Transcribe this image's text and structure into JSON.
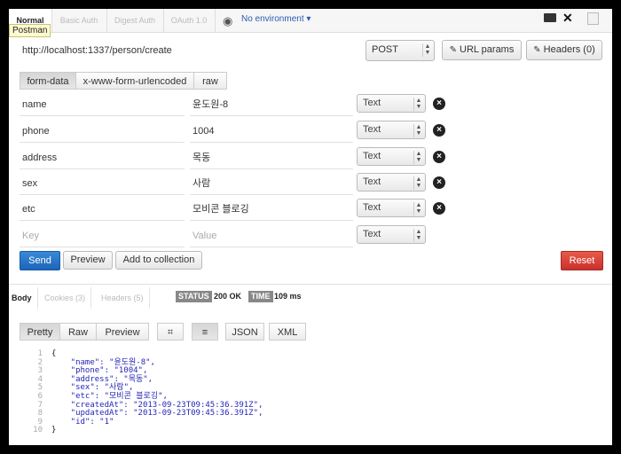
{
  "auth_tabs": [
    "Normal",
    "Basic Auth",
    "Digest Auth",
    "OAuth 1.0"
  ],
  "tooltip": "Postman",
  "environment": "No environment ▾",
  "url": "http://localhost:1337/person/create",
  "method": "POST",
  "url_params_label": "URL params",
  "headers_label": "Headers (0)",
  "body_modes": [
    "form-data",
    "x-www-form-urlencoded",
    "raw"
  ],
  "params": [
    {
      "key": "name",
      "value": "윤도원-8",
      "type": "Text"
    },
    {
      "key": "phone",
      "value": "1004",
      "type": "Text"
    },
    {
      "key": "address",
      "value": "목동",
      "type": "Text"
    },
    {
      "key": "sex",
      "value": "사람",
      "type": "Text"
    },
    {
      "key": "etc",
      "value": "모비콘 블로깅",
      "type": "Text"
    }
  ],
  "new_param": {
    "key_placeholder": "Key",
    "value_placeholder": "Value",
    "type": "Text"
  },
  "actions": {
    "send": "Send",
    "preview": "Preview",
    "add_to_collection": "Add to collection",
    "reset": "Reset"
  },
  "response": {
    "tabs": [
      "Body",
      "Cookies (3)",
      "Headers (5)"
    ],
    "status_label": "STATUS",
    "status_value": "200 OK",
    "time_label": "TIME",
    "time_value": "109 ms",
    "view_modes": [
      "Pretty",
      "Raw",
      "Preview"
    ],
    "format_modes": [
      "JSON",
      "XML"
    ],
    "code_lines": [
      {
        "n": "1",
        "text": "{"
      },
      {
        "n": "2",
        "text": "    \"name\": \"윤도원-8\","
      },
      {
        "n": "3",
        "text": "    \"phone\": \"1004\","
      },
      {
        "n": "4",
        "text": "    \"address\": \"목동\","
      },
      {
        "n": "5",
        "text": "    \"sex\": \"사람\","
      },
      {
        "n": "6",
        "text": "    \"etc\": \"모비콘 블로깅\","
      },
      {
        "n": "7",
        "text": "    \"createdAt\": \"2013-09-23T09:45:36.391Z\","
      },
      {
        "n": "8",
        "text": "    \"updatedAt\": \"2013-09-23T09:45:36.391Z\","
      },
      {
        "n": "9",
        "text": "    \"id\": \"1\""
      },
      {
        "n": "10",
        "text": "}"
      }
    ]
  },
  "colors": {
    "send": "#1c64b8",
    "reset": "#c9302c",
    "json_text": "#2424b8"
  },
  "icons": [
    "eye-icon",
    "keyboard-icon",
    "wrench-icon",
    "window-icon",
    "edit-icon",
    "close-icon",
    "expand-icon",
    "wrap-icon"
  ]
}
